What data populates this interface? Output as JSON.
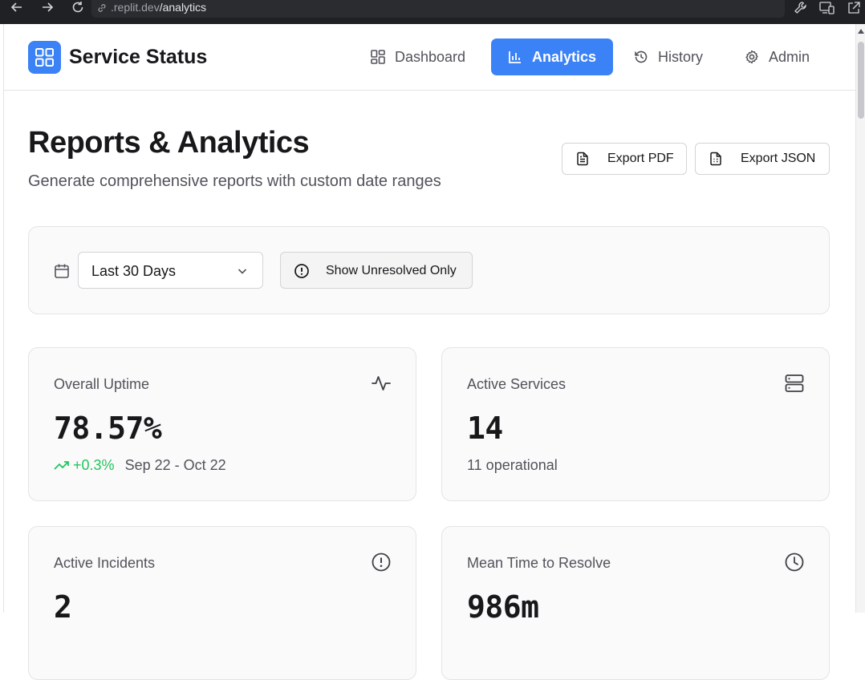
{
  "browser": {
    "url_prefix": ".replit.dev",
    "url_path": "/analytics"
  },
  "app": {
    "brand": "Service Status",
    "nav": [
      {
        "label": "Dashboard",
        "icon": "grid-icon",
        "active": false
      },
      {
        "label": "Analytics",
        "icon": "bar-chart-icon",
        "active": true
      },
      {
        "label": "History",
        "icon": "history-icon",
        "active": false
      },
      {
        "label": "Admin",
        "icon": "gear-icon",
        "active": false
      }
    ],
    "accent_color": "#3b82f6"
  },
  "page": {
    "title": "Reports & Analytics",
    "subtitle": "Generate comprehensive reports with custom date ranges",
    "export_pdf_label": "Export PDF",
    "export_json_label": "Export JSON"
  },
  "filters": {
    "date_range_selected": "Last 30 Days",
    "unresolved_toggle_label": "Show Unresolved Only"
  },
  "stats": {
    "uptime": {
      "label": "Overall Uptime",
      "value": "78.57%",
      "trend": "+0.3%",
      "range": "Sep 22 - Oct 22",
      "icon": "activity-icon"
    },
    "services": {
      "label": "Active Services",
      "value": "14",
      "meta": "11 operational",
      "icon": "server-icon"
    },
    "incidents": {
      "label": "Active Incidents",
      "value": "2",
      "icon": "alert-circle-icon"
    },
    "mttr": {
      "label": "Mean Time to Resolve",
      "value": "986m",
      "icon": "clock-icon"
    }
  },
  "colors": {
    "trend_positive": "#22c55e"
  }
}
